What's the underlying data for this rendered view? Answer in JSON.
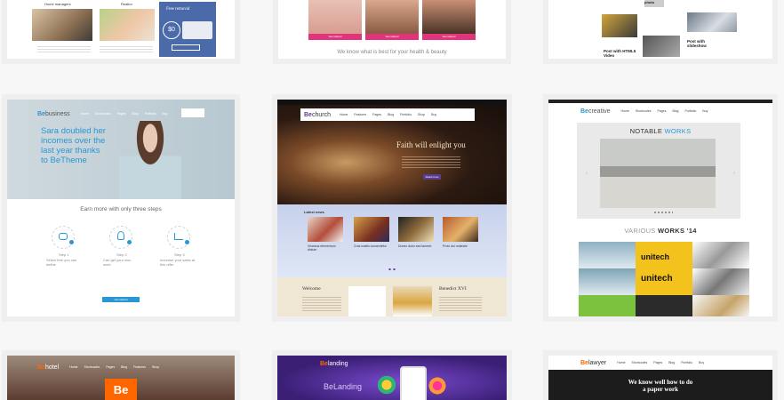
{
  "row1": {
    "card1": {
      "home_managers": "Home managers",
      "realtor": "Realtor",
      "free_removal": "Free removal",
      "price": "$0"
    },
    "card2": {
      "tagline": "We know what is best for your health & beauty",
      "btn1": "Get started",
      "btn2": "Get started",
      "btn3": "Get started"
    },
    "card3": {
      "photo": "photo",
      "post_slideshow": "Post with slideshow",
      "post_html5_line1": "Post with HTML5",
      "post_html5_line2": "Video"
    }
  },
  "business": {
    "logo_be": "Be",
    "logo_name": "business",
    "nav": [
      "Home",
      "Shortcodes",
      "Pages",
      "Blog",
      "Portfolio",
      "Buy"
    ],
    "headline_line1": "Sara doubled her",
    "headline_line2": "incomes over the",
    "headline_line3": "last year thanks",
    "headline_line4": "to BeTheme",
    "steps_title": "Earn more with only three steps",
    "steps": [
      {
        "label": "Step 1",
        "text": "Select free you can define"
      },
      {
        "label": "Step 2",
        "text": "Can get your own work"
      },
      {
        "label": "Step 3",
        "text": "Increase your sales at this offer"
      }
    ],
    "cta": "Get started"
  },
  "church": {
    "logo_be": "Be",
    "logo_name": "church",
    "nav": [
      "Home",
      "Features",
      "Pages",
      "Blog",
      "Portfolio",
      "Shop",
      "Buy"
    ],
    "hero_title": "Faith will enlight you",
    "hero_btn": "Read more",
    "latest_news": "Latest news",
    "news": [
      {
        "title": "Vivamus elementum dictum"
      },
      {
        "title": "Cras mattis consectetur"
      },
      {
        "title": "Donec dolor sed laoreet"
      },
      {
        "title": "Proin dui molestie"
      }
    ],
    "welcome": "Welcome",
    "benedict": "Benedict XVI"
  },
  "creative": {
    "logo_be": "Be",
    "logo_name": "creative",
    "nav": [
      "Home",
      "Shortcodes",
      "Pages",
      "Blog",
      "Portfolio",
      "Buy"
    ],
    "notable_prefix": "NOTABLE",
    "notable_suffix": "WORKS",
    "various_prefix": "VARIOUS",
    "various_suffix": "WORKS '14",
    "unitech1": "unitech",
    "unitech2": "unitech"
  },
  "row3": {
    "hotel": {
      "logo_be": "Be",
      "logo_name": "hotel",
      "nav": [
        "Home",
        "Shortcodes",
        "Pages",
        "Blog",
        "Features",
        "Shop"
      ],
      "big_be": "Be"
    },
    "landing": {
      "logo_be": "Be",
      "logo_name": "landing",
      "title": "BeLanding"
    },
    "lawyer": {
      "logo_be": "Be",
      "logo_name": "lawyer",
      "nav": [
        "Home",
        "Shortcodes",
        "Pages",
        "Blog",
        "Portfolio",
        "Buy"
      ],
      "headline_line1": "We know well how to do",
      "headline_line2": "a paper work"
    }
  },
  "colors": {
    "brand_orange": "#ff6600",
    "blue": "#2a96d4",
    "pink": "#e0357a",
    "church_purple": "#5b3d8f"
  }
}
